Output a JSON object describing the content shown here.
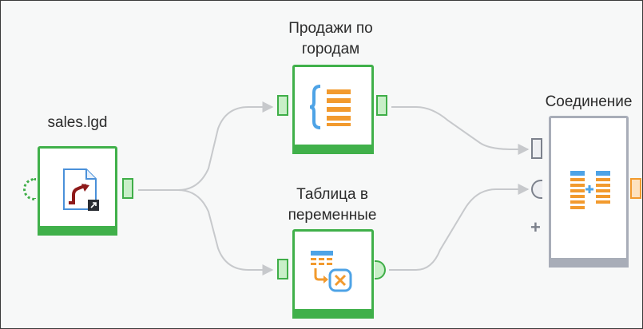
{
  "nodes": {
    "source": {
      "label": "sales.lgd",
      "icon": "file-dataset-icon"
    },
    "sales_by_city": {
      "label_line1": "Продажи по",
      "label_line2": "городам",
      "icon": "braces-list-icon"
    },
    "table_to_vars": {
      "label_line1": "Таблица в",
      "label_line2": "переменные",
      "icon": "table-to-variable-icon"
    },
    "join": {
      "label": "Соединение",
      "icon": "join-lists-icon"
    }
  },
  "colors": {
    "node_ok": "#40b04a",
    "node_idle": "#a8adb8",
    "edge": "#c7c9cc",
    "accent_orange": "#f29a2e",
    "accent_blue": "#4ea3e6"
  }
}
